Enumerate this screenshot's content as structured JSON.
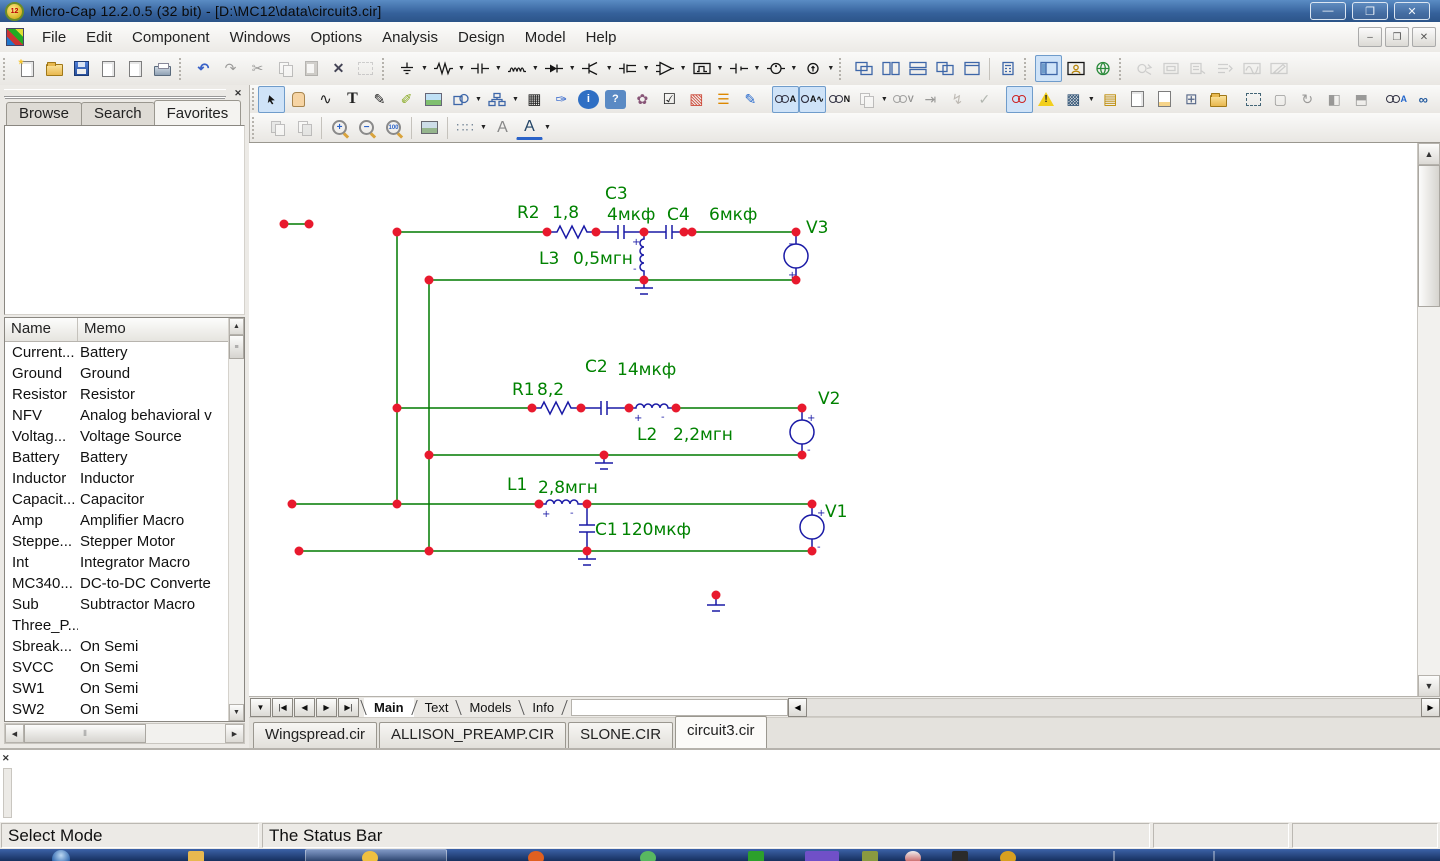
{
  "window": {
    "title": "Micro-Cap 12.2.0.5 (32 bit) - [D:\\MC12\\data\\circuit3.cir]",
    "controls": {
      "minimize": "—",
      "restore": "❐",
      "close": "✕"
    }
  },
  "menu": {
    "items": [
      "File",
      "Edit",
      "Component",
      "Windows",
      "Options",
      "Analysis",
      "Design",
      "Model",
      "Help"
    ]
  },
  "left_panel": {
    "tabs": [
      {
        "label": "Browse",
        "cls": ""
      },
      {
        "label": "Search",
        "cls": ""
      },
      {
        "label": "Favorites",
        "cls": "active"
      }
    ],
    "table": {
      "columns": {
        "name": "Name",
        "memo": "Memo"
      },
      "rows": [
        {
          "name": "Current...",
          "memo": "Battery"
        },
        {
          "name": "Ground",
          "memo": "Ground"
        },
        {
          "name": "Resistor",
          "memo": "Resistor"
        },
        {
          "name": "NFV",
          "memo": "Analog behavioral v"
        },
        {
          "name": "Voltag...",
          "memo": "Voltage Source"
        },
        {
          "name": "Battery",
          "memo": "Battery"
        },
        {
          "name": "Inductor",
          "memo": "Inductor"
        },
        {
          "name": "Capacit...",
          "memo": "Capacitor"
        },
        {
          "name": "Amp",
          "memo": "Amplifier Macro"
        },
        {
          "name": "Steppe...",
          "memo": "Stepper Motor"
        },
        {
          "name": "Int",
          "memo": "Integrator Macro"
        },
        {
          "name": "MC340...",
          "memo": "DC-to-DC Converte"
        },
        {
          "name": "Sub",
          "memo": "Subtractor Macro"
        },
        {
          "name": "Three_P...",
          "memo": ""
        },
        {
          "name": "Sbreak...",
          "memo": "On Semi"
        },
        {
          "name": "SVCC",
          "memo": "On Semi"
        },
        {
          "name": "SW1",
          "memo": "On Semi"
        },
        {
          "name": "SW2",
          "memo": "On Semi"
        }
      ]
    }
  },
  "schematic": {
    "components": {
      "r2": {
        "name": "R2",
        "value": "1,8"
      },
      "c3": {
        "name": "C3",
        "value": "4мкф"
      },
      "c4": {
        "name": "C4",
        "value": "6мкф"
      },
      "l3": {
        "name": "L3",
        "value": "0,5мгн"
      },
      "v3": {
        "name": "V3"
      },
      "r1": {
        "name": "R1",
        "value": "8,2"
      },
      "c2": {
        "name": "C2",
        "value": "14мкф"
      },
      "l2": {
        "name": "L2",
        "value": "2,2мгн"
      },
      "v2": {
        "name": "V2"
      },
      "l1": {
        "name": "L1",
        "value": "2,8мгн"
      },
      "c1": {
        "name": "C1",
        "value": "120мкф"
      },
      "v1": {
        "name": "V1"
      }
    },
    "colors": {
      "wire": "#007a00",
      "component": "#1a1aa6",
      "junction": "#e8192d",
      "label": "#008200"
    }
  },
  "sheet_tabs": [
    {
      "label": "Main",
      "cls": "active"
    },
    {
      "label": "Text",
      "cls": ""
    },
    {
      "label": "Models",
      "cls": ""
    },
    {
      "label": "Info",
      "cls": ""
    }
  ],
  "file_tabs": [
    {
      "label": "Wingspread.cir",
      "cls": ""
    },
    {
      "label": "ALLISON_PREAMP.CIR",
      "cls": ""
    },
    {
      "label": "SLONE.CIR",
      "cls": ""
    },
    {
      "label": "circuit3.cir",
      "cls": "active"
    }
  ],
  "status_bar": {
    "cells": [
      "Select Mode",
      "The Status Bar",
      "",
      ""
    ]
  },
  "icons": [
    "mc-app-icon",
    "minimize-icon",
    "restore-icon",
    "close-icon",
    "new-file-icon",
    "open-file-icon",
    "save-icon",
    "revert-icon",
    "print-preview-icon",
    "print-icon",
    "undo-icon",
    "redo-icon",
    "cut-icon",
    "copy-icon",
    "paste-icon",
    "delete-icon",
    "select-region-icon",
    "ground-icon",
    "resistor-icon",
    "capacitor-icon",
    "inductor-icon",
    "diode-icon",
    "transistor-icon",
    "mosfet-icon",
    "opamp-icon",
    "pulse-source-icon",
    "battery-icon",
    "voltage-source-icon",
    "current-source-icon",
    "cascade-icon",
    "tile-vertical-icon",
    "tile-horizontal-icon",
    "overlap-windows-icon",
    "maximize-window-icon",
    "calculator-icon",
    "panel-toggle-icon",
    "component-editor-icon",
    "internet-icon",
    "run-analysis-icon",
    "limits-icon",
    "stepping-icon",
    "optimizer-icon",
    "waveform-icon",
    "probe-icon",
    "select-mode-icon",
    "pan-mode-icon",
    "wire-mode-icon",
    "text-mode-icon",
    "line-mode-icon",
    "pencil-icon",
    "picture-icon",
    "shapes-icon",
    "flowchart-icon",
    "grid-table-icon",
    "info-icon",
    "help-mode-icon",
    "check-icon",
    "region-box-icon",
    "sheet-lines-icon",
    "note-icon",
    "show-attribute-text-icon",
    "show-values-icon",
    "show-node-names-icon",
    "show-voltages-icon",
    "node-snap-icon",
    "warning-icon",
    "grid-icon",
    "title-block-icon",
    "page-icon",
    "document-icon",
    "macro-icon",
    "properties-icon",
    "select-box-icon",
    "rotate-icon",
    "flip-x-icon",
    "flip-y-icon",
    "find-component-icon",
    "find-icon",
    "file-list-icon",
    "step-down-icon",
    "remove-icon",
    "more-icon",
    "bring-front-icon",
    "send-back-icon",
    "zoom-in-icon",
    "zoom-out-icon",
    "zoom-100-icon",
    "view-image-icon",
    "grid-dots-icon",
    "font-icon",
    "font-color-icon",
    "sheet-list-icon",
    "first-sheet-icon",
    "prev-sheet-icon",
    "next-sheet-icon",
    "last-sheet-icon",
    "scroll-up-icon",
    "scroll-down-icon",
    "scroll-left-icon",
    "scroll-right-icon",
    "output-close-icon",
    "panel-close-icon",
    "start-orb-icon"
  ]
}
